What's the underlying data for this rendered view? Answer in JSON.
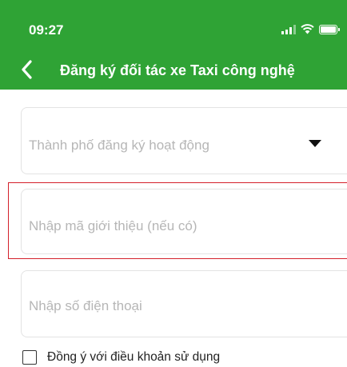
{
  "status_bar": {
    "time": "09:27"
  },
  "header": {
    "title": "Đăng ký đối tác xe Taxi công nghệ",
    "background_color": "#2fa335",
    "back_icon": "chevron-left-icon"
  },
  "form": {
    "city_select": {
      "placeholder": "Thành phố đăng ký hoạt động",
      "icon": "caret-down-icon"
    },
    "referral_input": {
      "placeholder": "Nhập mã giới thiệu (nếu có)",
      "highlight_color": "#d4202a"
    },
    "phone_input": {
      "placeholder": "Nhập số điện thoại"
    },
    "terms": {
      "label": "Đồng ý với điều khoản sử dụng",
      "checked": false
    }
  }
}
